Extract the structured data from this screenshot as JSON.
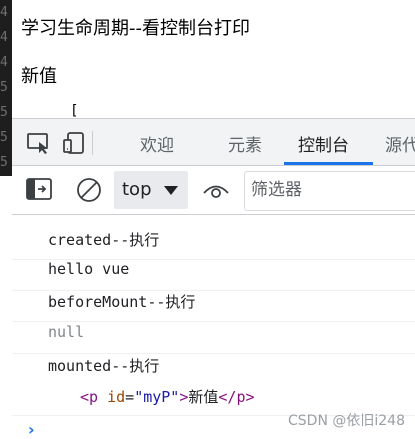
{
  "page": {
    "title": "学习生命周期--看控制台打印",
    "value": "新值",
    "bracket": "["
  },
  "gutter_digits": [
    "4",
    "4",
    "4",
    "5",
    "5",
    "5",
    "5"
  ],
  "devtools": {
    "tabs": [
      {
        "label": "欢迎",
        "active": false
      },
      {
        "label": "元素",
        "active": false
      },
      {
        "label": "控制台",
        "active": true
      },
      {
        "label": "源代",
        "active": false
      }
    ],
    "toolbar": {
      "context": "top",
      "filter_placeholder": "筛选器"
    },
    "console": {
      "logs": [
        "created--执行",
        "hello vue",
        "beforeMount--执行",
        "null",
        "mounted--执行"
      ],
      "element": {
        "open_tag": "<p",
        "attr_name": "id",
        "attr_eq": "=",
        "attr_value": "\"myP\"",
        "open_close": ">",
        "text": "新值",
        "close_tag": "</p>"
      },
      "prompt": "›"
    }
  },
  "watermark": "CSDN @依旧i248",
  "colors": {
    "accent": "#1a73e8",
    "tag": "#881280",
    "attr_name": "#994500",
    "attr_value": "#1a1aa6"
  }
}
